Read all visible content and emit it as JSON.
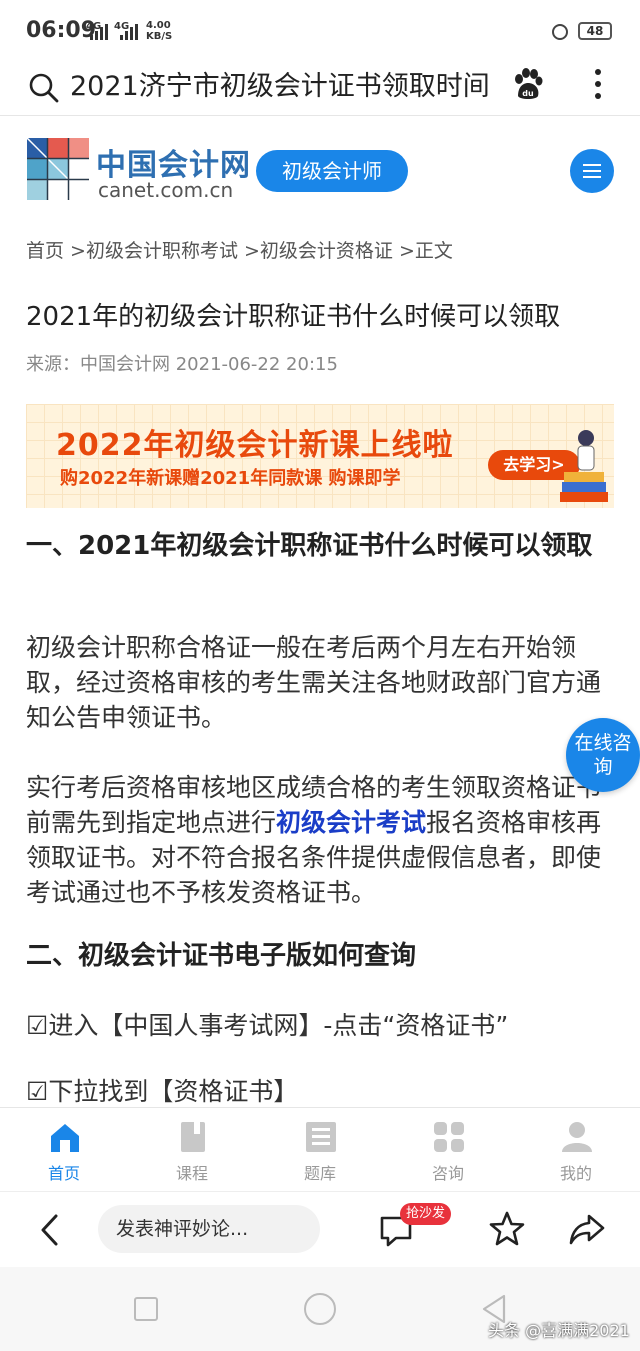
{
  "status_bar": {
    "time": "06:09",
    "signal1": "4G",
    "signal2": "4G",
    "speed_value": "4.00",
    "speed_unit": "KB/S",
    "battery": "48"
  },
  "search_bar": {
    "query": "2021济宁市初级会计证书领取时间",
    "icons": [
      "search-icon",
      "baidu-paw-icon",
      "more-vertical-icon"
    ]
  },
  "site_header": {
    "logo_cn": "中国会计网",
    "logo_en": "canet.com.cn",
    "category_button": "初级会计师",
    "accent_color": "#1a86e8"
  },
  "breadcrumb": "首页 >初级会计职称考试 >初级会计资格证 >正文",
  "article": {
    "title": "2021年的初级会计职称证书什么时候可以领取",
    "meta": "来源：中国会计网 2021-06-22 20:15",
    "banner": {
      "line1": "2022年初级会计新课上线啦",
      "line2": "购2022年新课赠2021年同款课 购课即学",
      "button": "去学习>",
      "color": "#e8490c"
    },
    "heading1": "一、2021年初级会计职称证书什么时候可以领取",
    "para1": "初级会计职称合格证一般在考后两个月左右开始领取，经过资格审核的考生需关注各地财政部门官方通知公告申领证书。",
    "para2_before": "实行考后资格审核地区成绩合格的考生领取资格证书前需先到指定地点进行",
    "para2_link": "初级会计考试",
    "para2_after": "报名资格审核再领取证书。对不符合报名条件提供虚假信息者，即使考试通过也不予核发资格证书。",
    "heading2": "二、初级会计证书电子版如何查询",
    "step1": "☑进入【中国人事考试网】-点击“资格证书”",
    "step2": "☑下拉找到【资格证书】"
  },
  "float_consult": "在线咨询",
  "tab_bar": [
    {
      "label": "首页",
      "icon": "home-icon",
      "active": true
    },
    {
      "label": "课程",
      "icon": "book-icon",
      "active": false
    },
    {
      "label": "题库",
      "icon": "question-bank-icon",
      "active": false
    },
    {
      "label": "咨询",
      "icon": "grid-icon",
      "active": false
    },
    {
      "label": "我的",
      "icon": "user-icon",
      "active": false
    }
  ],
  "action_bar": {
    "comment_placeholder": "发表神评妙论...",
    "badge": "抢沙发",
    "icons": [
      "back-arrow-icon",
      "comment-icon",
      "star-icon",
      "share-icon"
    ]
  },
  "watermark": "头条 @喜满满2021"
}
